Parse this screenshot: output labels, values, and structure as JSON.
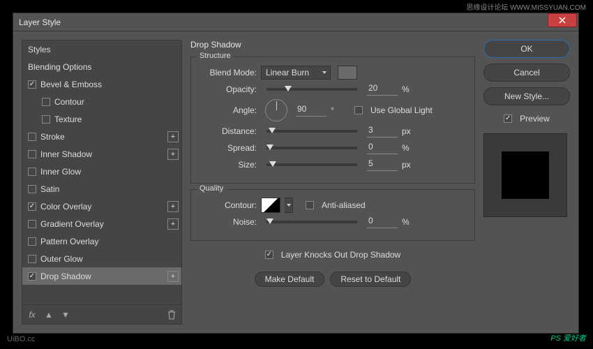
{
  "watermark": {
    "top": "思缘设计论坛 WWW.MISSYUAN.COM",
    "bottom": "PS 爱好者",
    "left": "UiBO.cc"
  },
  "dialog_title": "Layer Style",
  "styles_panel": {
    "items": [
      {
        "label": "Styles",
        "type": "header"
      },
      {
        "label": "Blending Options",
        "type": "header"
      },
      {
        "label": "Bevel & Emboss",
        "type": "check",
        "checked": true
      },
      {
        "label": "Contour",
        "type": "check",
        "checked": false,
        "sub": true
      },
      {
        "label": "Texture",
        "type": "check",
        "checked": false,
        "sub": true
      },
      {
        "label": "Stroke",
        "type": "check",
        "checked": false,
        "plus": true
      },
      {
        "label": "Inner Shadow",
        "type": "check",
        "checked": false,
        "plus": true
      },
      {
        "label": "Inner Glow",
        "type": "check",
        "checked": false
      },
      {
        "label": "Satin",
        "type": "check",
        "checked": false
      },
      {
        "label": "Color Overlay",
        "type": "check",
        "checked": true,
        "plus": true
      },
      {
        "label": "Gradient Overlay",
        "type": "check",
        "checked": false,
        "plus": true
      },
      {
        "label": "Pattern Overlay",
        "type": "check",
        "checked": false
      },
      {
        "label": "Outer Glow",
        "type": "check",
        "checked": false
      },
      {
        "label": "Drop Shadow",
        "type": "check",
        "checked": true,
        "plus": true,
        "selected": true
      }
    ],
    "footer_fx": "fx"
  },
  "settings": {
    "title": "Drop Shadow",
    "structure": {
      "label": "Structure",
      "blend_mode": {
        "label": "Blend Mode:",
        "value": "Linear Burn"
      },
      "opacity": {
        "label": "Opacity:",
        "value": "20",
        "unit": "%",
        "pct": 20
      },
      "angle": {
        "label": "Angle:",
        "value": "90",
        "unit": "°",
        "global": "Use Global Light",
        "global_checked": false
      },
      "distance": {
        "label": "Distance:",
        "value": "3",
        "unit": "px",
        "pct": 2
      },
      "spread": {
        "label": "Spread:",
        "value": "0",
        "unit": "%",
        "pct": 0
      },
      "size": {
        "label": "Size:",
        "value": "5",
        "unit": "px",
        "pct": 3
      }
    },
    "quality": {
      "label": "Quality",
      "contour": {
        "label": "Contour:",
        "anti": "Anti-aliased",
        "anti_checked": false
      },
      "noise": {
        "label": "Noise:",
        "value": "0",
        "unit": "%",
        "pct": 0
      }
    },
    "knockout": {
      "label": "Layer Knocks Out Drop Shadow",
      "checked": true
    },
    "make_default": "Make Default",
    "reset_default": "Reset to Default"
  },
  "buttons": {
    "ok": "OK",
    "cancel": "Cancel",
    "new_style": "New Style...",
    "preview": "Preview",
    "preview_checked": true
  }
}
